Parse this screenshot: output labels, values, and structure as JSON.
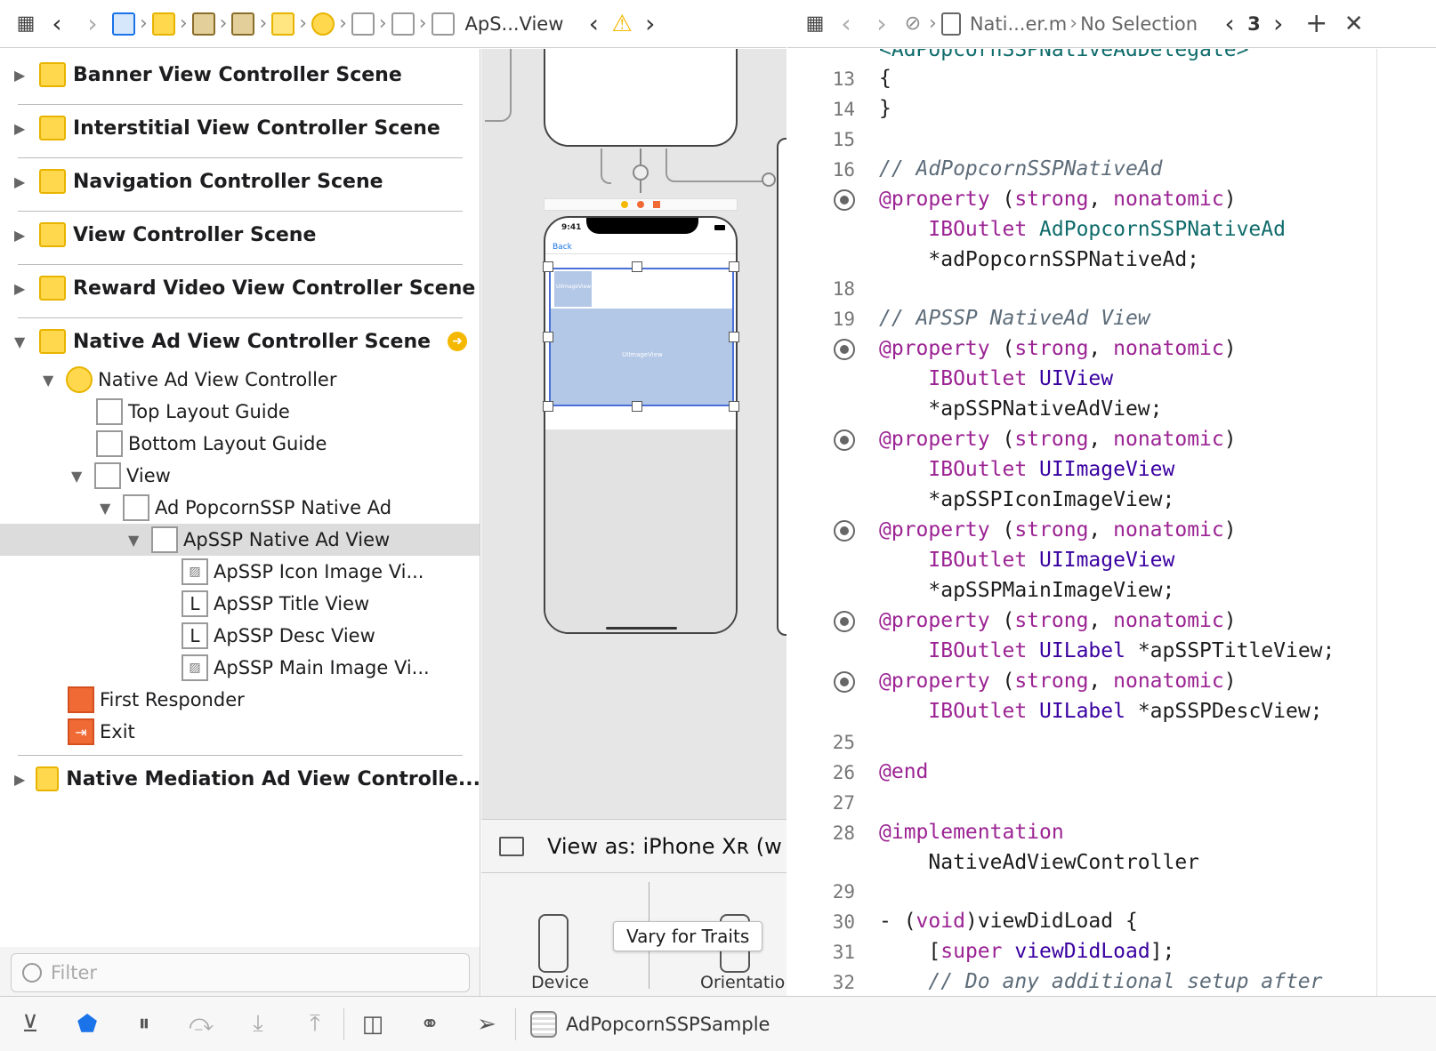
{
  "left_jumpbar": {
    "breadcrumb_last": "ApS...View",
    "warning": "⚠"
  },
  "right_jumpbar": {
    "file": "Nati...er.m",
    "selection": "No Selection",
    "count": "3"
  },
  "outline": {
    "scenes": [
      "Banner View Controller Scene",
      "Interstitial View Controller Scene",
      "Navigation Controller Scene",
      "View Controller Scene",
      "Reward Video View Controller Scene",
      "Native Ad View Controller Scene",
      "Native Mediation Ad View Controlle..."
    ],
    "tree": {
      "controller": "Native Ad View Controller",
      "top_guide": "Top Layout Guide",
      "bottom_guide": "Bottom Layout Guide",
      "view": "View",
      "ad": "Ad PopcornSSP Native Ad",
      "ad_view": "ApSSP Native Ad View",
      "icon_image": "ApSSP Icon Image Vi...",
      "title_view": "ApSSP Title View",
      "desc_view": "ApSSP Desc View",
      "main_image": "ApSSP Main Image Vi...",
      "first_responder": "First Responder",
      "exit": "Exit"
    },
    "filter_placeholder": "Filter"
  },
  "canvas": {
    "time": "9:41",
    "back": "Back",
    "image_label_1": "UIImageView",
    "image_label_2": "UIImageView",
    "view_as": "View as: iPhone Xʀ (w",
    "device": "Device",
    "orientation": "Orientatio",
    "tooltip": "Vary for Traits"
  },
  "code": {
    "lines": [
      {
        "n": "",
        "t": "<AdPopcornSSPNativeAdDelegate>"
      },
      {
        "n": "13",
        "t": "{"
      },
      {
        "n": "14",
        "t": "}"
      },
      {
        "n": "15",
        "t": ""
      },
      {
        "n": "16",
        "t": "// AdPopcornSSPNativeAd"
      },
      {
        "n": "",
        "t": "@property (strong, nonatomic)"
      },
      {
        "n": "",
        "t": "    IBOutlet AdPopcornSSPNativeAd"
      },
      {
        "n": "",
        "t": "    *adPopcornSSPNativeAd;"
      },
      {
        "n": "18",
        "t": ""
      },
      {
        "n": "19",
        "t": "// APSSP NativeAd View"
      },
      {
        "n": "",
        "t": "@property (strong, nonatomic)"
      },
      {
        "n": "",
        "t": "    IBOutlet UIView"
      },
      {
        "n": "",
        "t": "    *apSSPNativeAdView;"
      },
      {
        "n": "",
        "t": "@property (strong, nonatomic)"
      },
      {
        "n": "",
        "t": "    IBOutlet UIImageView"
      },
      {
        "n": "",
        "t": "    *apSSPIconImageView;"
      },
      {
        "n": "",
        "t": "@property (strong, nonatomic)"
      },
      {
        "n": "",
        "t": "    IBOutlet UIImageView"
      },
      {
        "n": "",
        "t": "    *apSSPMainImageView;"
      },
      {
        "n": "",
        "t": "@property (strong, nonatomic)"
      },
      {
        "n": "",
        "t": "    IBOutlet UILabel *apSSPTitleView;"
      },
      {
        "n": "",
        "t": "@property (strong, nonatomic)"
      },
      {
        "n": "",
        "t": "    IBOutlet UILabel *apSSPDescView;"
      },
      {
        "n": "25",
        "t": ""
      },
      {
        "n": "26",
        "t": "@end"
      },
      {
        "n": "27",
        "t": ""
      },
      {
        "n": "28",
        "t": "@implementation"
      },
      {
        "n": "",
        "t": "    NativeAdViewController"
      },
      {
        "n": "29",
        "t": ""
      },
      {
        "n": "30",
        "t": "- (void)viewDidLoad {"
      },
      {
        "n": "31",
        "t": "    [super viewDidLoad];"
      },
      {
        "n": "32",
        "t": "    // Do any additional setup after"
      }
    ]
  },
  "bottombar": {
    "scheme": "AdPopcornSSPSample"
  },
  "colors": {
    "keyword": "#9b2393",
    "comment": "#5d6c79",
    "type": "#3900a0",
    "project_type": "#0f6b6b",
    "accent": "#1a73e8",
    "scene_icon": "#ffd84d"
  }
}
